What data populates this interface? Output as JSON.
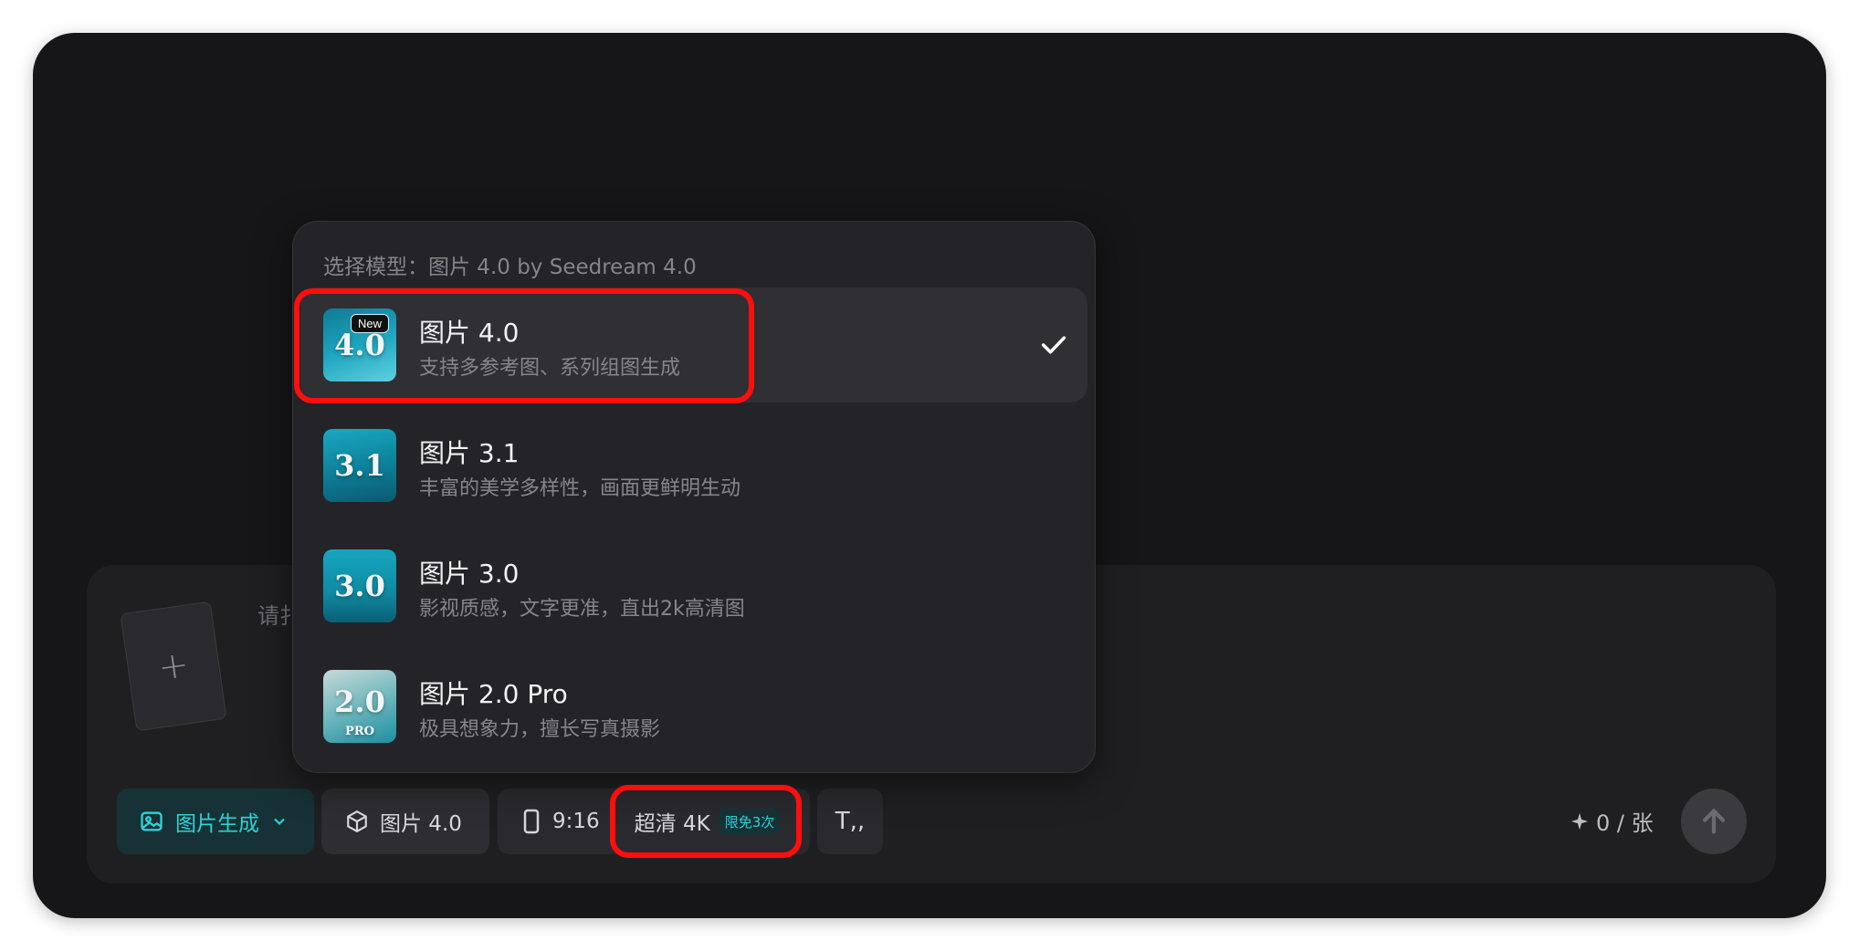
{
  "dropdown": {
    "header": "选择模型：图片 4.0 by Seedream 4.0",
    "models": [
      {
        "title": "图片 4.0",
        "desc": "支持多参考图、系列组图生成",
        "thumb": "4.0",
        "badge": "New",
        "selected": true
      },
      {
        "title": "图片 3.1",
        "desc": "丰富的美学多样性，画面更鲜明生动",
        "thumb": "3.1",
        "selected": false
      },
      {
        "title": "图片 3.0",
        "desc": "影视质感，文字更准，直出2k高清图",
        "thumb": "3.0",
        "selected": false
      },
      {
        "title": "图片 2.0 Pro",
        "desc": "极具想象力，擅长写真摄影",
        "thumb": "2.0",
        "thumb_sub": "PRO",
        "selected": false
      }
    ]
  },
  "composer": {
    "prompt_placeholder": "请扌",
    "upload_symbol": "+"
  },
  "toolbar": {
    "mode_label": "图片生成",
    "model_label": "图片 4.0",
    "ratio_label": "9:16",
    "resolution_label": "超清 4K",
    "free_badge": "限免3次",
    "text_tool_symbol": "T,,",
    "credits": "0 / 张"
  },
  "colors": {
    "accent": "#2cd3d6",
    "highlight": "#ff0e0e",
    "window_bg": "#161618"
  }
}
